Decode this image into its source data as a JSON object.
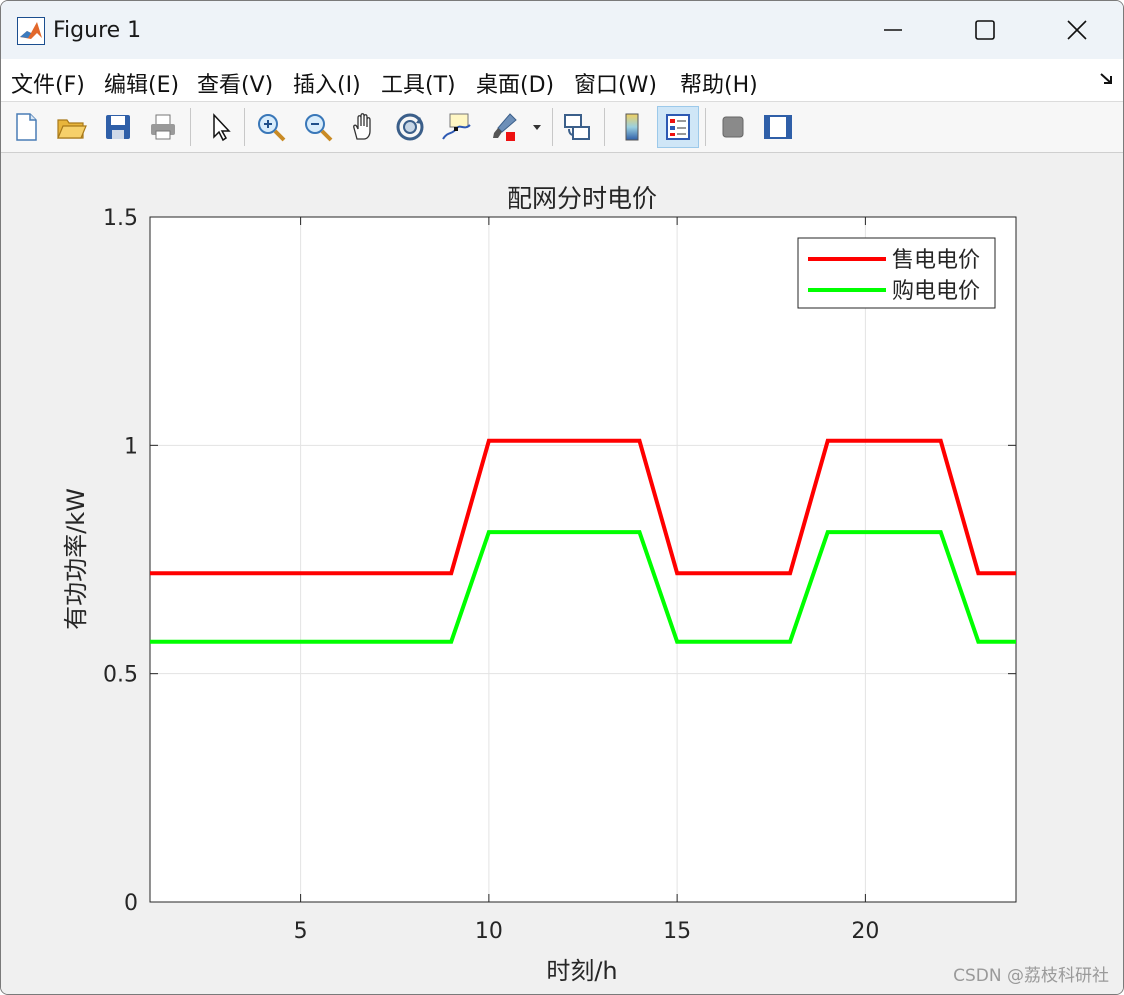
{
  "window": {
    "title": "Figure 1"
  },
  "menu": {
    "items": [
      "文件(F)",
      "编辑(E)",
      "查看(V)",
      "插入(I)",
      "工具(T)",
      "桌面(D)",
      "窗口(W)",
      "帮助(H)"
    ]
  },
  "toolbar": {
    "buttons": [
      {
        "icon": "new-figure-icon"
      },
      {
        "icon": "open-file-icon"
      },
      {
        "icon": "save-icon"
      },
      {
        "icon": "print-icon"
      },
      {
        "icon": "select-arrow-icon"
      },
      {
        "icon": "zoom-in-icon"
      },
      {
        "icon": "zoom-out-icon"
      },
      {
        "icon": "pan-hand-icon"
      },
      {
        "icon": "rotate-3d-icon"
      },
      {
        "icon": "data-cursor-icon"
      },
      {
        "icon": "brush-icon"
      },
      {
        "icon": "link-plot-icon"
      },
      {
        "icon": "colorbar-icon"
      },
      {
        "icon": "legend-icon"
      },
      {
        "icon": "hide-plot-tools-icon"
      },
      {
        "icon": "show-plot-tools-icon"
      }
    ]
  },
  "watermark": "CSDN @荔枝科研社",
  "chart_data": {
    "type": "line",
    "title": "配网分时电价",
    "xlabel": "时刻/h",
    "ylabel": "有功功率/kW",
    "xlim": [
      1,
      24
    ],
    "ylim": [
      0,
      1.5
    ],
    "xticks": [
      5,
      10,
      15,
      20
    ],
    "yticks": [
      0,
      0.5,
      1,
      1.5
    ],
    "ytick_labels": [
      "0",
      "0.5",
      "1",
      "1.5"
    ],
    "grid": true,
    "legend_position": "top-right",
    "x": [
      1,
      2,
      3,
      4,
      5,
      6,
      7,
      8,
      9,
      10,
      11,
      12,
      13,
      14,
      15,
      16,
      17,
      18,
      19,
      20,
      21,
      22,
      23,
      24
    ],
    "series": [
      {
        "name": "售电电价",
        "color": "#ff0000",
        "values": [
          0.72,
          0.72,
          0.72,
          0.72,
          0.72,
          0.72,
          0.72,
          0.72,
          0.72,
          1.01,
          1.01,
          1.01,
          1.01,
          1.01,
          0.72,
          0.72,
          0.72,
          0.72,
          1.01,
          1.01,
          1.01,
          1.01,
          0.72,
          0.72
        ]
      },
      {
        "name": "购电电价",
        "color": "#00ff00",
        "values": [
          0.57,
          0.57,
          0.57,
          0.57,
          0.57,
          0.57,
          0.57,
          0.57,
          0.57,
          0.81,
          0.81,
          0.81,
          0.81,
          0.81,
          0.57,
          0.57,
          0.57,
          0.57,
          0.81,
          0.81,
          0.81,
          0.81,
          0.57,
          0.57
        ]
      }
    ]
  }
}
